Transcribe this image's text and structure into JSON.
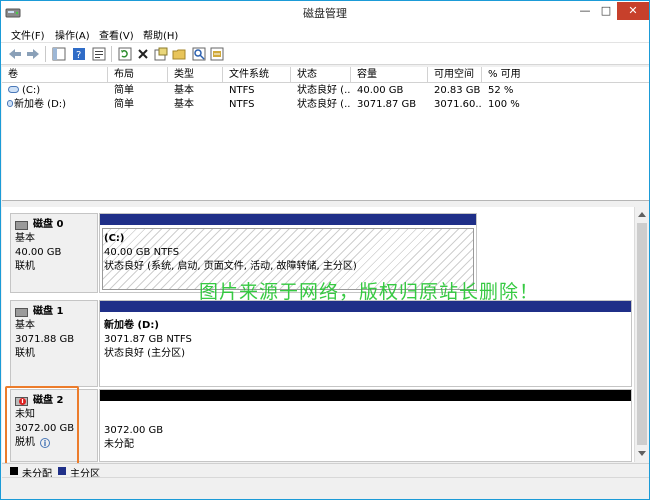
{
  "window": {
    "title": "磁盘管理",
    "controls": {
      "minimize": "—",
      "maximize": "□",
      "close": "✕"
    }
  },
  "menu": [
    {
      "label": "文件(F)"
    },
    {
      "label": "操作(A)"
    },
    {
      "label": "查看(V)"
    },
    {
      "label": "帮助(H)"
    }
  ],
  "toolbar": {
    "icons": [
      "back-arrow-icon",
      "forward-arrow-icon",
      "console-tree-icon",
      "help-icon",
      "properties-icon",
      "refresh-icon",
      "delete-icon",
      "format-icon",
      "open-folder-icon",
      "search-icon",
      "rescan-icon"
    ]
  },
  "volume_table": {
    "columns": [
      "卷",
      "布局",
      "类型",
      "文件系统",
      "状态",
      "容量",
      "可用空间",
      "% 可用"
    ],
    "rows": [
      {
        "name": "(C:)",
        "layout": "简单",
        "type": "基本",
        "fs": "NTFS",
        "status": "状态良好 (...",
        "capacity": "40.00 GB",
        "free": "20.83 GB",
        "pct": "52 %"
      },
      {
        "name": "新加卷 (D:)",
        "layout": "简单",
        "type": "基本",
        "fs": "NTFS",
        "status": "状态良好 (...",
        "capacity": "3071.87 GB",
        "free": "3071.60...",
        "pct": "100 %"
      }
    ]
  },
  "disks": [
    {
      "name": "磁盘 0",
      "type": "基本",
      "size": "40.00 GB",
      "state": "联机",
      "partition": {
        "title": "(C:)",
        "size": "40.00 GB NTFS",
        "status": "状态良好 (系统, 启动, 页面文件, 活动, 故障转储, 主分区)"
      }
    },
    {
      "name": "磁盘 1",
      "type": "基本",
      "size": "3071.88 GB",
      "state": "联机",
      "partition": {
        "title": "新加卷  (D:)",
        "size": "3071.87 GB NTFS",
        "status": "状态良好 (主分区)"
      }
    },
    {
      "name": "磁盘 2",
      "type": "未知",
      "size": "3072.00 GB",
      "state": "脱机",
      "partition": {
        "title": "",
        "size": "3072.00 GB",
        "status": "未分配"
      }
    }
  ],
  "legend": [
    {
      "label": "未分配",
      "color": "#000000"
    },
    {
      "label": "主分区",
      "color": "#1f2f88"
    }
  ],
  "watermark": "图片来源于网络，版权归原站长删除！",
  "colors": {
    "accent": "#1b9bd7",
    "primary_partition": "#1f2f88",
    "highlight": "#ec7c2b",
    "watermark": "#22c52f"
  }
}
